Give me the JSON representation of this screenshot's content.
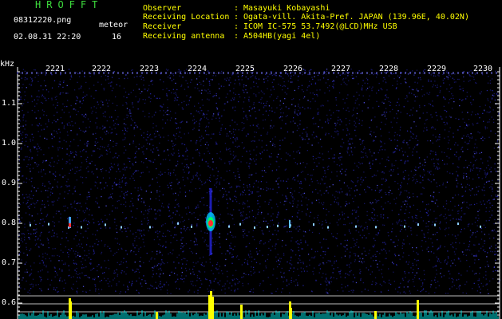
{
  "header": {
    "app_title": "HROFFT",
    "file_name": "08312220.png",
    "timestamp": "02.08.31 22:20",
    "detect_type": "meteor",
    "detect_count": "16"
  },
  "info": [
    {
      "label": "Observer",
      "value": "Masayuki Kobayashi"
    },
    {
      "label": "Receiving Location",
      "value": "Ogata-vill. Akita-Pref. JAPAN (139.96E, 40.02N)"
    },
    {
      "label": "Receiver",
      "value": "ICOM IC-575 53.7492(@LCD)MHz USB"
    },
    {
      "label": "Receiving antenna",
      "value": "A504HB(yagi 4el)"
    }
  ],
  "info_separator": ":",
  "axis": {
    "freq_unit": "kHz",
    "freq_ticks": [
      "1.1",
      "1.0",
      "0.9",
      "0.8",
      "0.7",
      "0.6"
    ],
    "time_ticks": [
      "2221",
      "2222",
      "2223",
      "2224",
      "2225",
      "2226",
      "2227",
      "2228",
      "2229",
      "2230"
    ]
  },
  "colors": {
    "title_green": "#3ddc3d",
    "info_yellow": "#ffff00",
    "text_white": "#ffffff",
    "noise_blue": "#1a1a8c",
    "spike_yellow": "#ffff00",
    "spike_cyan": "#00e0e0",
    "echo_red": "#ff3030"
  }
}
